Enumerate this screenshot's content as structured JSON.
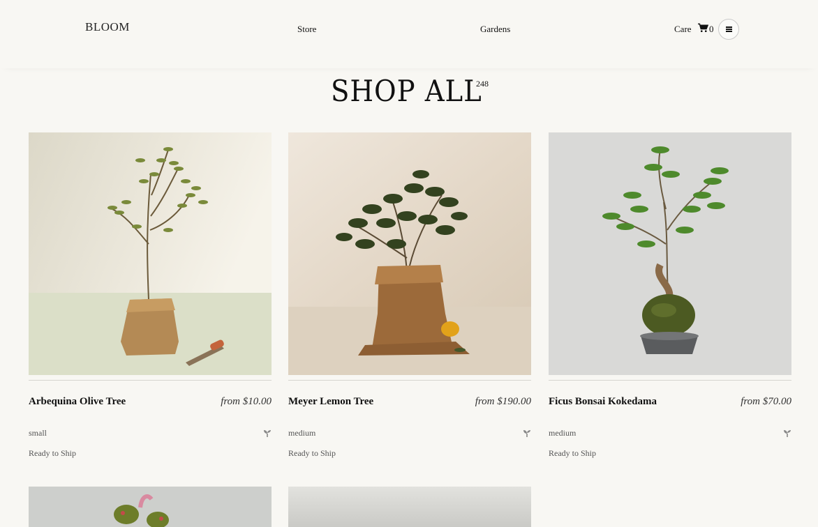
{
  "header": {
    "logo": "BLOOM",
    "nav": {
      "store": "Store",
      "gardens": "Gardens",
      "care": "Care"
    },
    "cart_count": "0"
  },
  "page": {
    "title": "SHOP ALL",
    "count": "248"
  },
  "products": [
    {
      "name": "Arbequina Olive Tree",
      "price": "from $10.00",
      "size": "small",
      "shipping": "Ready to Ship",
      "image": "olive-tree-burlap"
    },
    {
      "name": "Meyer Lemon Tree",
      "price": "from $190.00",
      "size": "medium",
      "shipping": "Ready to Ship",
      "image": "lemon-tree-burlap"
    },
    {
      "name": "Ficus Bonsai Kokedama",
      "price": "from $70.00",
      "size": "medium",
      "shipping": "Ready to Ship",
      "image": "ficus-kokedama"
    }
  ],
  "colors": {
    "background": "#f8f7f3",
    "text": "#111111",
    "muted": "#555555",
    "divider": "#d6d5d0"
  }
}
